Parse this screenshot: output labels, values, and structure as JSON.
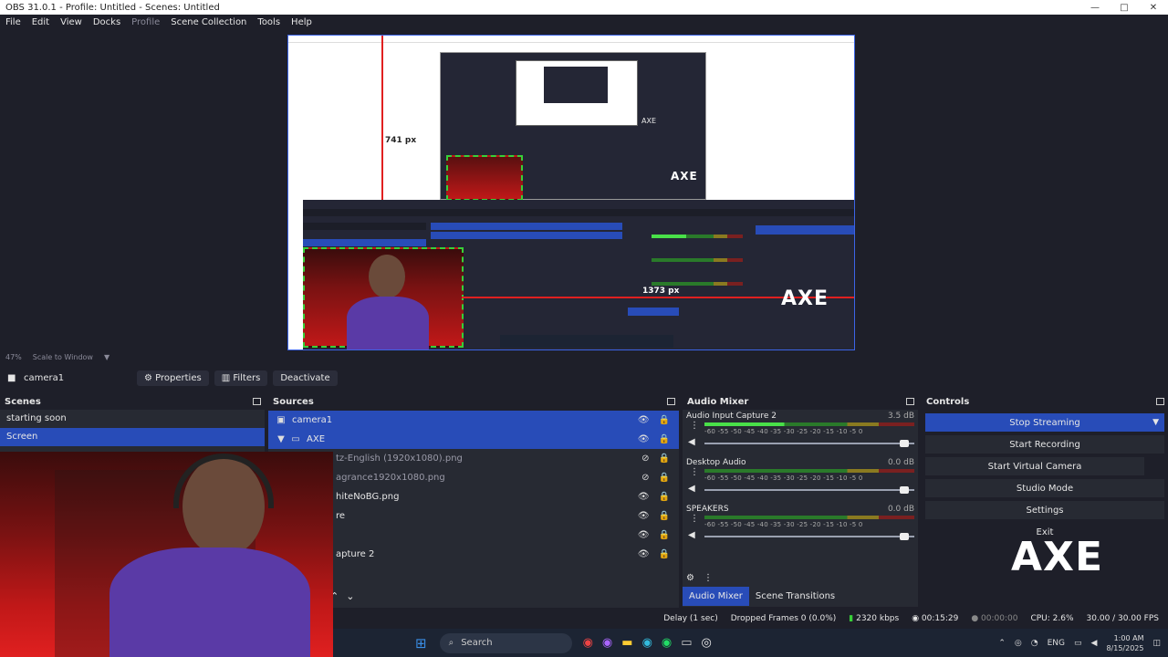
{
  "window": {
    "title": "OBS 31.0.1 - Profile: Untitled - Scenes: Untitled",
    "controls": [
      "—",
      "□",
      "✕"
    ]
  },
  "menu": [
    "File",
    "Edit",
    "View",
    "Docks",
    "Profile",
    "Scene Collection",
    "Tools",
    "Help"
  ],
  "preview": {
    "measure_vertical": "741 px",
    "measure_horizontal": "1373 px",
    "logo_text": "AXE",
    "zoom": "47%",
    "scale_mode": "Scale to Window"
  },
  "source_toolbar": {
    "selected_source": "camera1",
    "properties": "Properties",
    "filters": "Filters",
    "deactivate": "Deactivate"
  },
  "scenes": {
    "title": "Scenes",
    "items": [
      "starting soon",
      "Screen"
    ],
    "active_index": 1
  },
  "sources": {
    "title": "Sources",
    "items": [
      {
        "name": "camera1",
        "selected": true
      },
      {
        "name": "AXE",
        "selected": true
      },
      {
        "name": "tz-English (1920x1080).png",
        "selected": false,
        "hidden": true
      },
      {
        "name": "agrance1920x1080.png",
        "selected": false,
        "hidden": true
      },
      {
        "name": "hiteNoBG.png",
        "selected": false
      },
      {
        "name": "re",
        "selected": false
      },
      {
        "name": "",
        "selected": false
      },
      {
        "name": "apture 2",
        "selected": false
      }
    ]
  },
  "mixer": {
    "title": "Audio Mixer",
    "tracks": [
      {
        "name": "Audio Input Capture 2",
        "db": "3.5 dB",
        "level": 0.38
      },
      {
        "name": "Desktop Audio",
        "db": "0.0 dB",
        "level": 0.0
      },
      {
        "name": "SPEAKERS",
        "db": "0.0 dB",
        "level": 0.0
      }
    ],
    "scale": "-60 -55 -50 -45 -40 -35 -30 -25 -20 -15 -10 -5 0",
    "tab_mixer": "Audio Mixer",
    "tab_transitions": "Scene Transitions"
  },
  "controls": {
    "title": "Controls",
    "stop_streaming": "Stop Streaming",
    "start_recording": "Start Recording",
    "start_virtual_camera": "Start Virtual Camera",
    "studio_mode": "Studio Mode",
    "settings": "Settings",
    "exit": "Exit"
  },
  "status": {
    "delay": "Delay (1 sec)",
    "dropped": "Dropped Frames 0 (0.0%)",
    "bitrate": "2320 kbps",
    "stream_time": "00:15:29",
    "rec_time": "00:00:00",
    "cpu": "CPU: 2.6%",
    "fps": "30.00 / 30.00 FPS"
  },
  "taskbar": {
    "search": "Search",
    "lang": "ENG",
    "time": "1:00 AM",
    "date": "8/15/2025"
  },
  "colors": {
    "accent": "#284cb8",
    "meter_green": "#49e049",
    "meter_yellow": "#8a7a20",
    "meter_red": "#7a2020",
    "guide_red": "#e02020"
  }
}
